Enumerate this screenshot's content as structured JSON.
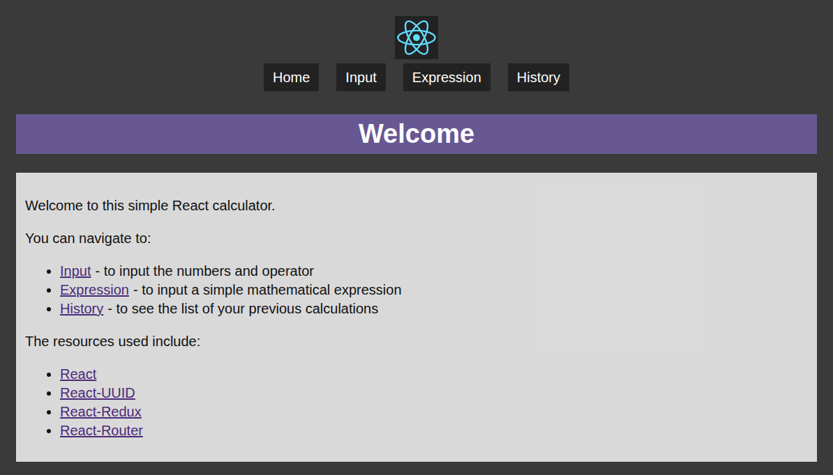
{
  "nav": [
    {
      "label": "Home",
      "selected": false
    },
    {
      "label": "Input",
      "selected": false
    },
    {
      "label": "Expression",
      "selected": false
    },
    {
      "label": "History",
      "selected": false
    }
  ],
  "heading": "Welcome",
  "content": {
    "intro": "Welcome to this simple React calculator.",
    "navigate_label": "You can navigate to:",
    "pages": [
      {
        "link": "Input",
        "description": "- to input the numbers and operator"
      },
      {
        "link": "Expression",
        "description": "- to input a simple mathematical expression"
      },
      {
        "link": "History",
        "description": "- to see the list of your previous calculations"
      }
    ],
    "resources_label": "The resources used include:",
    "resources": [
      "React",
      "React-UUID",
      "React-Redux",
      "React-Router"
    ]
  }
}
